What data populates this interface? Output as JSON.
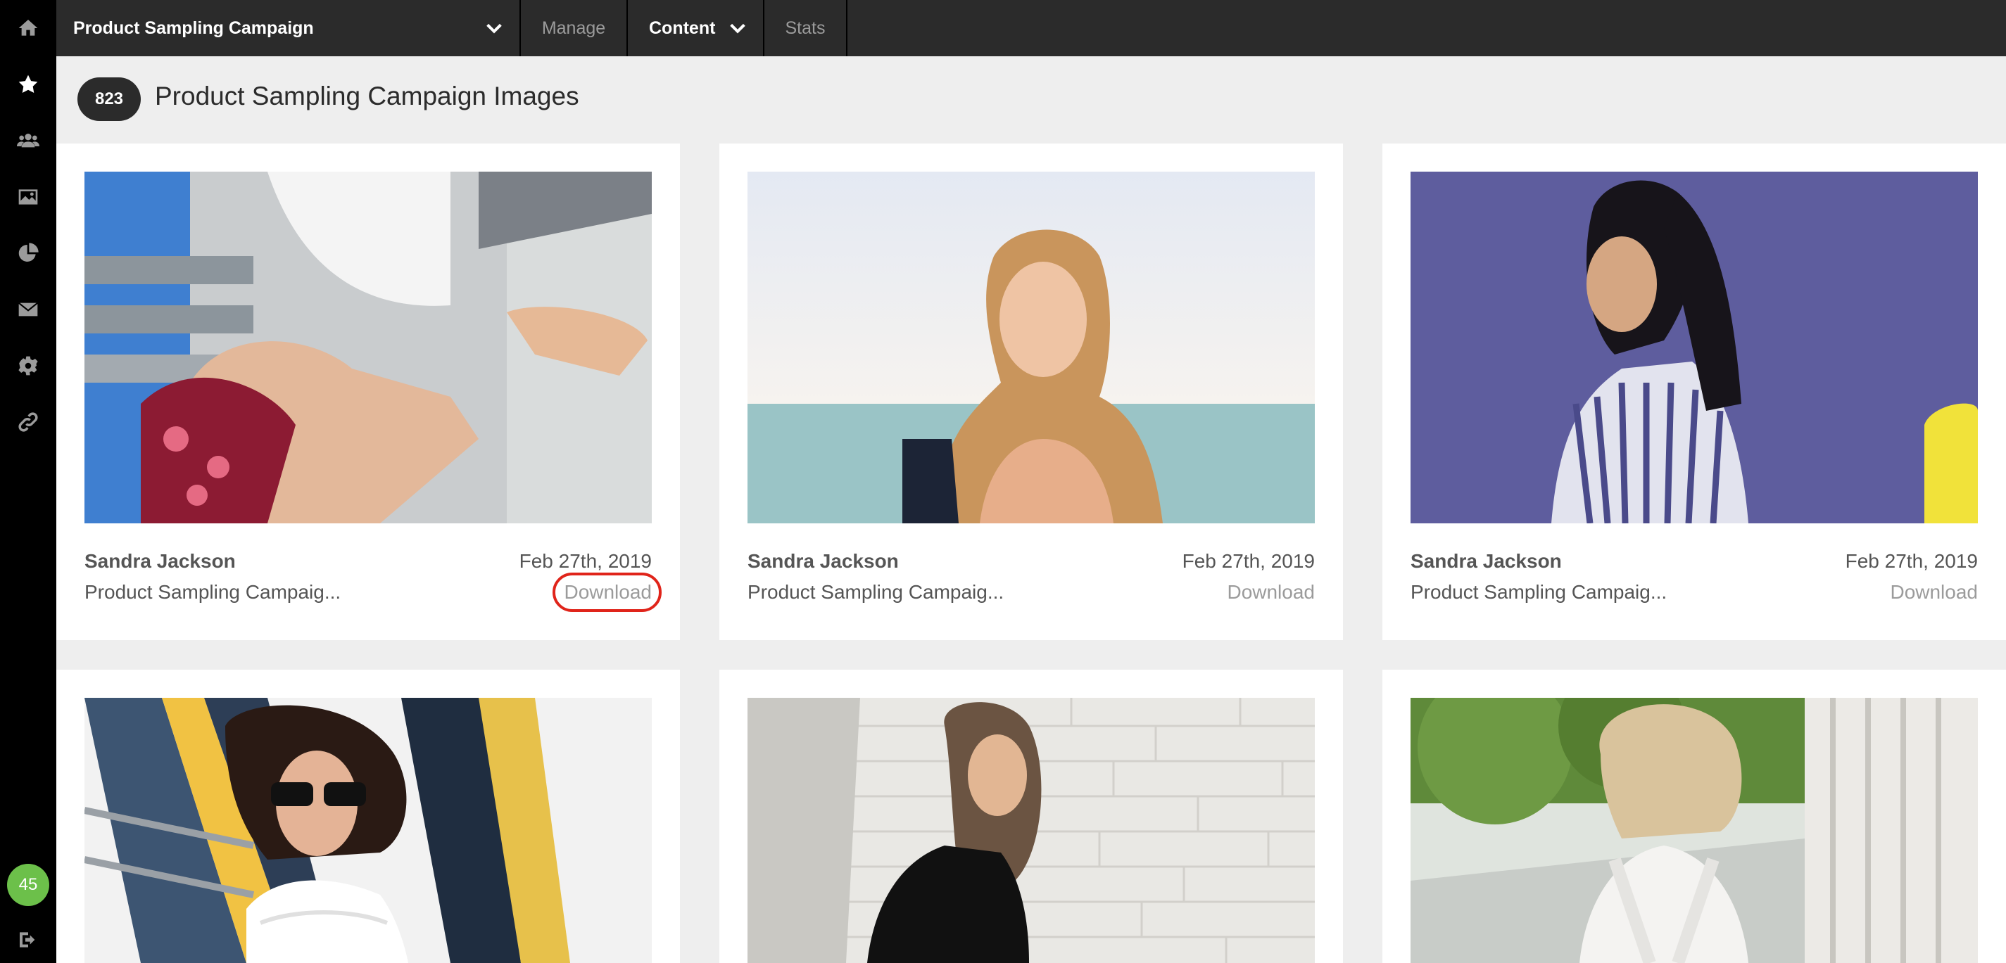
{
  "sidebar": {
    "icons": [
      "home-icon",
      "star-icon",
      "users-icon",
      "image-icon",
      "pie-chart-icon",
      "envelope-icon",
      "gear-icon",
      "link-icon",
      "logout-icon"
    ],
    "notification_count": "45",
    "active_color": "#ffffff",
    "inactive_color": "#9b9b9b",
    "badge_color": "#6cc04a"
  },
  "topbar": {
    "campaign": "Product Sampling Campaign",
    "tabs": {
      "manage": "Manage",
      "content": "Content",
      "stats": "Stats"
    }
  },
  "header": {
    "count": "823",
    "title": "Product Sampling Campaign Images"
  },
  "cards": [
    {
      "name": "Sandra Jackson",
      "date": "Feb 27th, 2019",
      "campaign": "Product Sampling Campaig...",
      "download": "Download"
    },
    {
      "name": "Sandra Jackson",
      "date": "Feb 27th, 2019",
      "campaign": "Product Sampling Campaig...",
      "download": "Download"
    },
    {
      "name": "Sandra Jackson",
      "date": "Feb 27th, 2019",
      "campaign": "Product Sampling Campaig...",
      "download": "Download"
    },
    {
      "name": "",
      "date": "",
      "campaign": "",
      "download": ""
    },
    {
      "name": "",
      "date": "",
      "campaign": "",
      "download": ""
    },
    {
      "name": "",
      "date": "",
      "campaign": "",
      "download": ""
    }
  ],
  "colors": {
    "highlight_ring": "#e0241a",
    "topbar": "#2b2b2b",
    "sidebar": "#000000"
  }
}
